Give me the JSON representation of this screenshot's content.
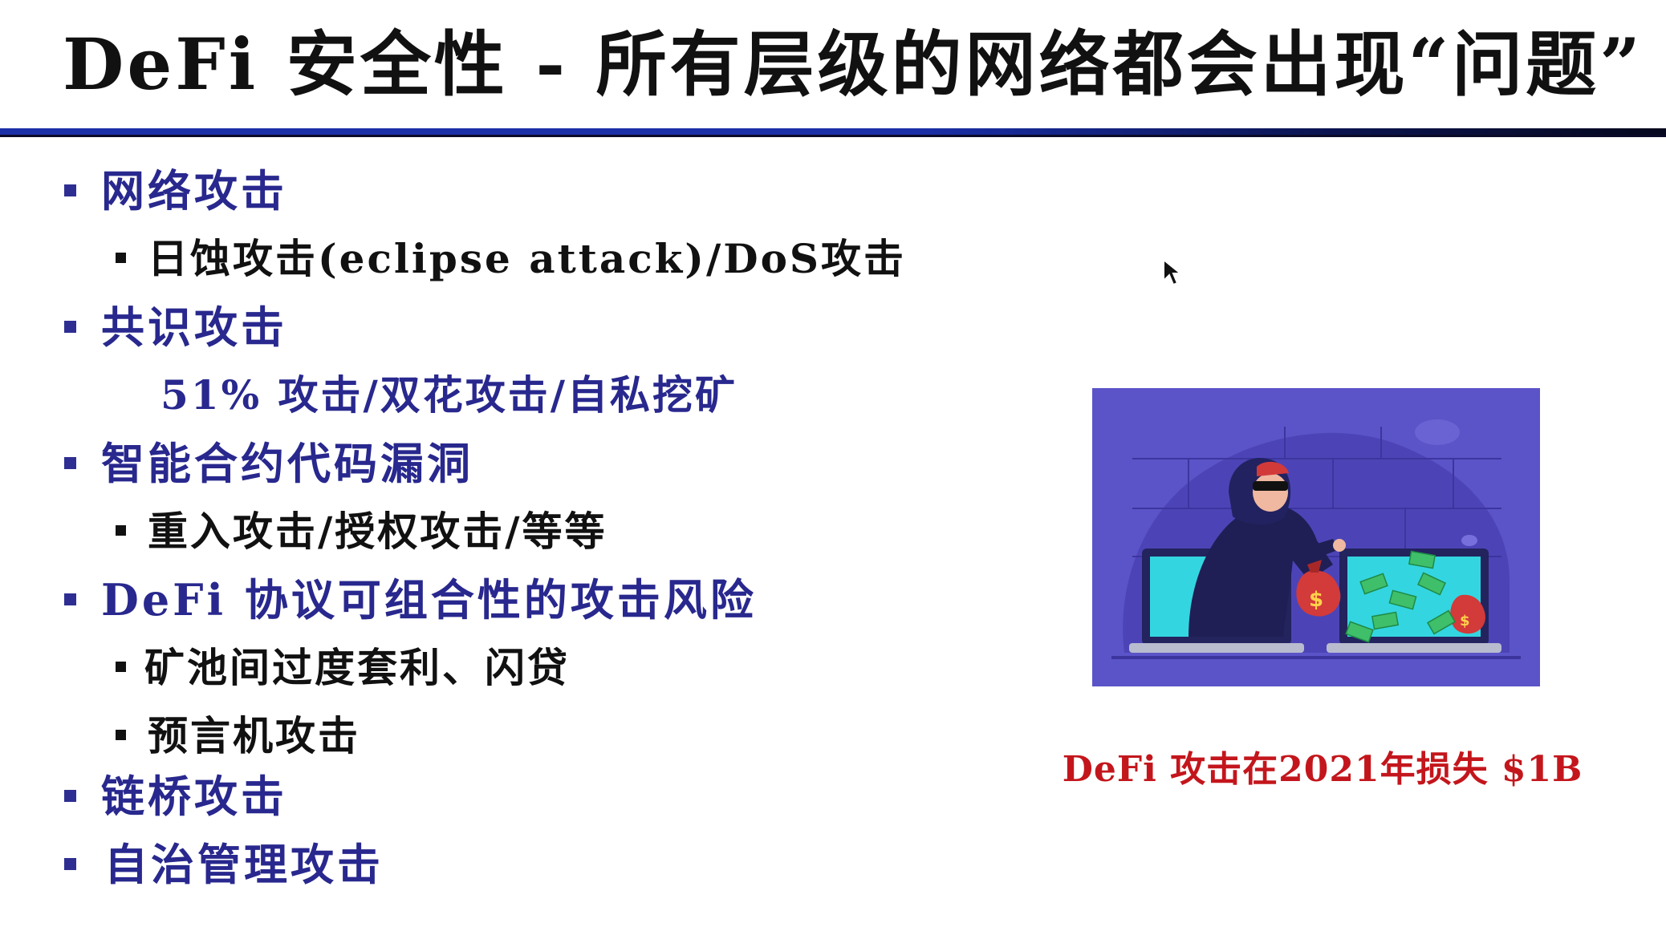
{
  "title": "DeFi 安全性 - 所有层级的网络都会出现“问题”",
  "sections": [
    {
      "label": "网络攻击",
      "items": [
        "日蚀攻击(eclipse attack)/DoS攻击"
      ]
    },
    {
      "label": "共识攻击",
      "plain": "51% 攻击/双花攻击/自私挖矿"
    },
    {
      "label": "智能合约代码漏洞",
      "items": [
        "重入攻击/授权攻击/等等"
      ]
    },
    {
      "label": "DeFi 协议可组合性的攻击风险",
      "items": [
        "矿池间过度套利、闪贷",
        "预言机攻击"
      ]
    },
    {
      "label": "链桥攻击"
    },
    {
      "label": "自治管理攻击"
    }
  ],
  "image_caption": "DeFi 攻击在2021年损失 $1B",
  "colors": {
    "accent_blue": "#28288e",
    "caption_red": "#c3161c",
    "illustration_bg": "#5b54c8"
  },
  "icons": [
    "mouse-cursor-icon",
    "money-bag-icon",
    "laptop-icon",
    "hacker-illustration"
  ]
}
